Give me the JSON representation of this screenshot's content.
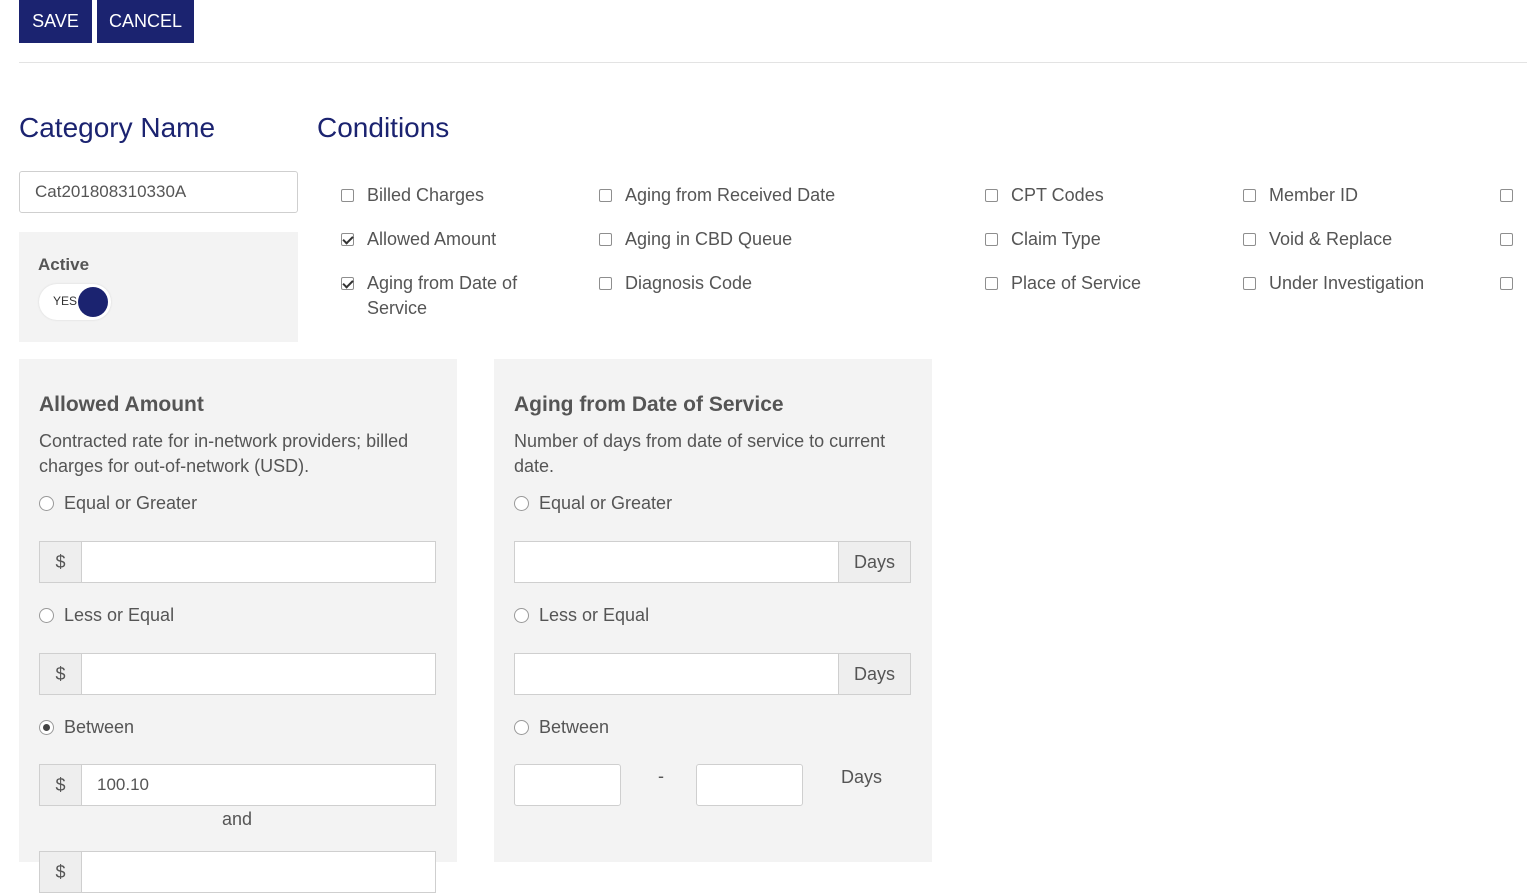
{
  "toolbar": {
    "save_label": "SAVE",
    "cancel_label": "CANCEL"
  },
  "category": {
    "heading": "Category Name",
    "name_value": "Cat201808310330A"
  },
  "active": {
    "label": "Active",
    "toggle_text": "YES",
    "on": true
  },
  "conditions": {
    "heading": "Conditions",
    "items": [
      {
        "label": "Billed Charges",
        "checked": false
      },
      {
        "label": "Aging from Received Date",
        "checked": false
      },
      {
        "label": "CPT Codes",
        "checked": false
      },
      {
        "label": "Member ID",
        "checked": false
      },
      {
        "label": "",
        "checked": false
      },
      {
        "label": "Allowed Amount",
        "checked": true
      },
      {
        "label": "Aging in CBD Queue",
        "checked": false
      },
      {
        "label": "Claim Type",
        "checked": false
      },
      {
        "label": "Void & Replace",
        "checked": false
      },
      {
        "label": "",
        "checked": false
      },
      {
        "label": "Aging from Date of Service",
        "checked": true
      },
      {
        "label": "Diagnosis Code",
        "checked": false
      },
      {
        "label": "Place of Service",
        "checked": false
      },
      {
        "label": "Under Investigation",
        "checked": false
      },
      {
        "label": "",
        "checked": false
      }
    ]
  },
  "allowed_amount": {
    "title": "Allowed Amount",
    "description": "Contracted rate for in-network providers; billed charges for out-of-network (USD).",
    "currency_symbol": "$",
    "option_ge": "Equal or Greater",
    "option_le": "Less or Equal",
    "option_between": "Between",
    "selected": "between",
    "ge_value": "",
    "le_value": "",
    "between_from": "100.10",
    "between_to": "",
    "and_label": "and"
  },
  "aging_dos": {
    "title": "Aging from Date of Service",
    "description": "Number of days from date of service to current date.",
    "option_ge": "Equal or Greater",
    "option_le": "Less or Equal",
    "option_between": "Between",
    "selected": "none",
    "days_label": "Days",
    "range_separator": "-",
    "ge_value": "",
    "le_value": "",
    "between_from": "",
    "between_to": ""
  },
  "colors": {
    "primary": "#1b2370",
    "panel_bg": "#f3f3f3",
    "text": "#555555"
  }
}
